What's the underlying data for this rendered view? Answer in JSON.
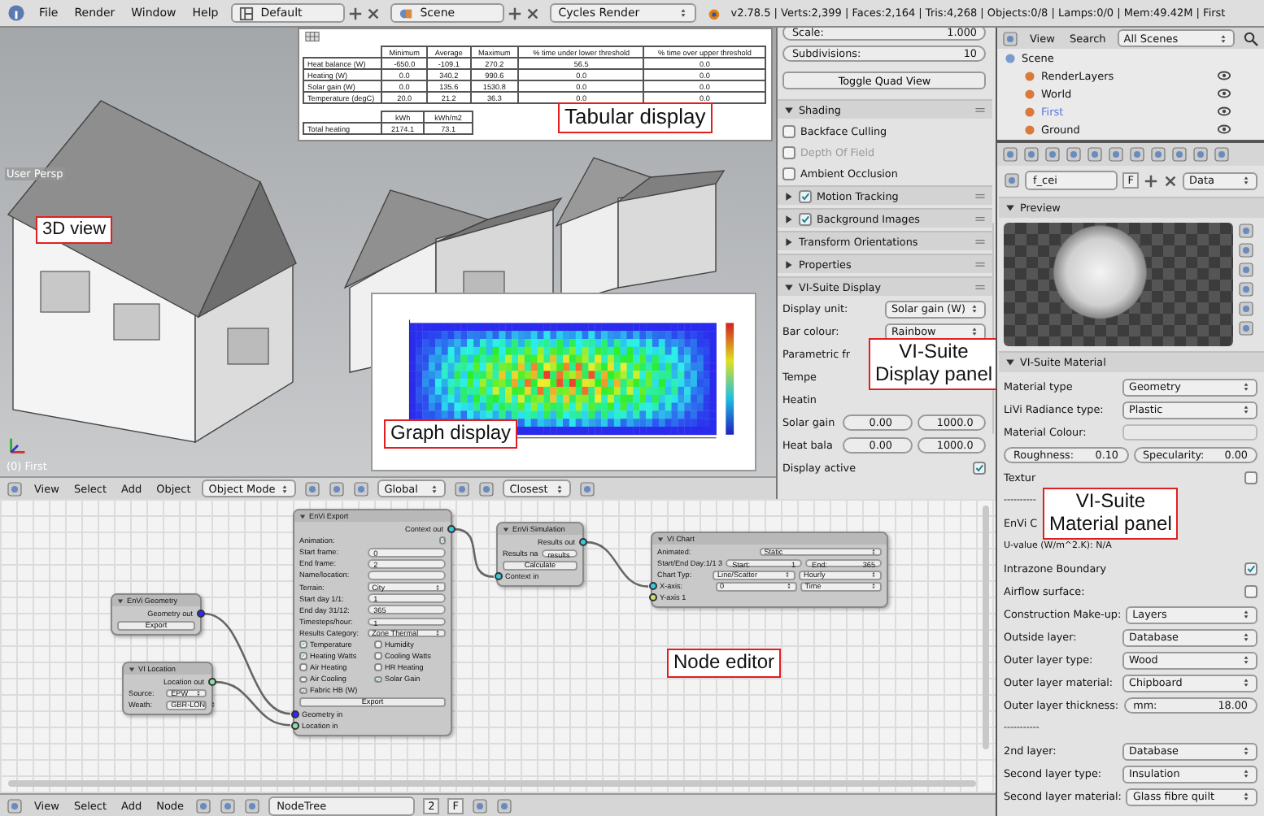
{
  "top_bar": {
    "menus": [
      "File",
      "Render",
      "Window",
      "Help"
    ],
    "layout": "Default",
    "scene": "Scene",
    "engine": "Cycles Render",
    "stats": "v2.78.5 | Verts:2,399 | Faces:2,164 | Tris:4,268 | Objects:0/8 | Lamps:0/0 | Mem:49.42M | First"
  },
  "viewport": {
    "view_label": "User Persp",
    "object_label": "(0) First",
    "annotation": "3D view",
    "header": {
      "menus": [
        "View",
        "Select",
        "Add",
        "Object"
      ],
      "mode": "Object Mode",
      "orientation": "Global",
      "snap": "Closest"
    }
  },
  "tabular_display": {
    "annotation": "Tabular display",
    "columns": [
      "Minimum",
      "Average",
      "Maximum",
      "% time under lower threshold",
      "% time over upper threshold"
    ],
    "rows": [
      {
        "label": "Heat balance (W)",
        "cells": [
          "-650.0",
          "-109.1",
          "270.2",
          "56.5",
          "0.0"
        ]
      },
      {
        "label": "Heating (W)",
        "cells": [
          "0.0",
          "340.2",
          "990.6",
          "0.0",
          "0.0"
        ]
      },
      {
        "label": "Solar gain (W)",
        "cells": [
          "0.0",
          "135.6",
          "1530.8",
          "0.0",
          "0.0"
        ]
      },
      {
        "label": "Temperature (degC)",
        "cells": [
          "20.0",
          "21.2",
          "36.3",
          "0.0",
          "0.0"
        ]
      }
    ],
    "totals_columns": [
      "kWh",
      "kWh/m2"
    ],
    "totals_rows": [
      {
        "label": "Total heating",
        "cells": [
          "2174.1",
          "73.1"
        ]
      }
    ]
  },
  "graph_display": {
    "annotation": "Graph display"
  },
  "view_panel": {
    "annotation": [
      "VI-Suite",
      "Display panel"
    ],
    "items": [
      {
        "kind": "numfield",
        "label": "Scale:",
        "value": "1.000"
      },
      {
        "kind": "numfield",
        "label": "Subdivisions:",
        "value": "10"
      },
      {
        "kind": "button",
        "label": "Toggle Quad View"
      },
      {
        "kind": "panel",
        "title": "Shading",
        "expanded": true
      },
      {
        "kind": "checkbox",
        "label": "Backface Culling",
        "checked": false,
        "disabled": false
      },
      {
        "kind": "checkbox",
        "label": "Depth Of Field",
        "checked": false,
        "disabled": true
      },
      {
        "kind": "checkbox",
        "label": "Ambient Occlusion",
        "checked": false,
        "disabled": false
      },
      {
        "kind": "panel",
        "title": "Motion Tracking",
        "expanded": false,
        "checked": true
      },
      {
        "kind": "panel",
        "title": "Background Images",
        "expanded": false,
        "checked": true
      },
      {
        "kind": "panel",
        "title": "Transform Orientations",
        "expanded": false
      },
      {
        "kind": "panel",
        "title": "Properties",
        "expanded": false
      },
      {
        "kind": "panel",
        "title": "VI-Suite Display",
        "expanded": true
      },
      {
        "kind": "dropdown",
        "label": "Display unit:",
        "value": "Solar gain (W)"
      },
      {
        "kind": "dropdown",
        "label": "Bar colour:",
        "value": "Rainbow"
      },
      {
        "kind": "covered",
        "label": "Parametric fr"
      },
      {
        "kind": "covered",
        "label": "Tempe"
      },
      {
        "kind": "covered",
        "label": "Heatin"
      },
      {
        "kind": "range",
        "label": "Solar gain",
        "min": "0.00",
        "max": "1000.0"
      },
      {
        "kind": "range",
        "label": "Heat bala",
        "min": "0.00",
        "max": "1000.0"
      },
      {
        "kind": "toggle",
        "label": "Display active",
        "checked": true
      }
    ]
  },
  "outliner": {
    "menus": [
      "View",
      "Search"
    ],
    "filter": "All Scenes",
    "items": [
      {
        "label": "Scene",
        "selected": false,
        "children": [
          {
            "label": "RenderLayers",
            "selected": false
          },
          {
            "label": "World",
            "selected": false
          },
          {
            "label": "First",
            "selected": true
          },
          {
            "label": "Ground",
            "selected": false
          }
        ]
      }
    ]
  },
  "properties": {
    "material_name": "f_cei",
    "fake_user": "F",
    "link": "Data",
    "preview_title": "Preview",
    "panel_title": "VI-Suite Material",
    "annotation": [
      "VI-Suite",
      "Material panel"
    ],
    "items": [
      {
        "kind": "dropdown",
        "label": "Material type",
        "value": "Geometry"
      },
      {
        "kind": "dropdown",
        "label": "LiVi Radiance type:",
        "value": "Plastic"
      },
      {
        "kind": "swatch",
        "label": "Material Colour:"
      },
      {
        "kind": "pair",
        "fields": [
          {
            "label": "Roughness:",
            "value": "0.10"
          },
          {
            "label": "Specularity:",
            "value": "0.00"
          }
        ]
      },
      {
        "kind": "toggle",
        "label": "Textur",
        "checked": false
      },
      {
        "kind": "text",
        "label": "----------"
      },
      {
        "kind": "covered",
        "label": "EnVi C"
      },
      {
        "kind": "text",
        "label": "U-value (W/m^2.K): N/A"
      },
      {
        "kind": "toggle",
        "label": "Intrazone Boundary",
        "checked": true
      },
      {
        "kind": "toggle",
        "label": "Airflow surface:",
        "checked": false
      },
      {
        "kind": "dropdown",
        "label": "Construction Make-up:",
        "value": "Layers"
      },
      {
        "kind": "dropdown",
        "label": "Outside layer:",
        "value": "Database"
      },
      {
        "kind": "dropdown",
        "label": "Outer layer type:",
        "value": "Wood"
      },
      {
        "kind": "dropdown",
        "label": "Outer layer material:",
        "value": "Chipboard"
      },
      {
        "kind": "numrow",
        "label": "Outer layer thickness:",
        "field": {
          "label": "mm:",
          "value": "18.00"
        }
      },
      {
        "kind": "text",
        "label": "-----------"
      },
      {
        "kind": "dropdown",
        "label": "2nd layer:",
        "value": "Database"
      },
      {
        "kind": "dropdown",
        "label": "Second layer type:",
        "value": "Insulation"
      },
      {
        "kind": "dropdown",
        "label": "Second layer material:",
        "value": "Glass fibre quilt"
      }
    ]
  },
  "node_editor": {
    "annotation": "Node editor",
    "nodes": [
      {
        "title": "EnVi Geometry",
        "rows": [
          {
            "kind": "output",
            "label": "Geometry out",
            "color": "#2a2aff"
          },
          {
            "kind": "button",
            "label": "Export"
          }
        ]
      },
      {
        "title": "VI Location",
        "rows": [
          {
            "kind": "output",
            "label": "Location out",
            "color": "#8fe0a8"
          },
          {
            "kind": "dropdown",
            "label": "Source:",
            "value": "EPW"
          },
          {
            "kind": "dropdown",
            "label": "Weath:",
            "value": "GBR-LON"
          }
        ]
      },
      {
        "title": "EnVi Export",
        "rows": [
          {
            "kind": "output",
            "label": "Context out",
            "color": "#38c8e0"
          },
          {
            "kind": "toggle",
            "label": "Animation:",
            "checked": true
          },
          {
            "kind": "field",
            "label": "Start frame:",
            "value": "0"
          },
          {
            "kind": "field",
            "label": "End frame:",
            "value": "2"
          },
          {
            "kind": "emptyfield",
            "label": "Name/location:"
          },
          {
            "kind": "dropdown",
            "label": "Terrain:",
            "value": "City"
          },
          {
            "kind": "field",
            "label": "Start day 1/1:",
            "value": "1"
          },
          {
            "kind": "field",
            "label": "End day 31/12:",
            "value": "365"
          },
          {
            "kind": "field",
            "label": "Timesteps/hour:",
            "value": "1"
          },
          {
            "kind": "dropdown",
            "label": "Results Category:",
            "value": "Zone Thermal"
          },
          {
            "kind": "checks",
            "items": [
              {
                "label": "Temperature",
                "checked": true
              },
              {
                "label": "Humidity",
                "checked": false
              }
            ]
          },
          {
            "kind": "checks",
            "items": [
              {
                "label": "Heating Watts",
                "checked": true
              },
              {
                "label": "Cooling Watts",
                "checked": false
              }
            ]
          },
          {
            "kind": "checks",
            "items": [
              {
                "label": "Air Heating",
                "checked": false
              },
              {
                "label": "HR Heating",
                "checked": false
              }
            ]
          },
          {
            "kind": "checks",
            "items": [
              {
                "label": "Air Cooling",
                "checked": false
              },
              {
                "label": "Solar Gain",
                "checked": true
              }
            ]
          },
          {
            "kind": "checks",
            "items": [
              {
                "label": "Fabric HB (W)",
                "checked": true
              }
            ]
          },
          {
            "kind": "button",
            "label": "Export"
          },
          {
            "kind": "input",
            "label": "Geometry in",
            "color": "#2a2aff"
          },
          {
            "kind": "input",
            "label": "Location in",
            "color": "#8fe0a8"
          }
        ]
      },
      {
        "title": "EnVi Simulation",
        "rows": [
          {
            "kind": "output",
            "label": "Results out",
            "color": "#38c8e0"
          },
          {
            "kind": "field",
            "label": "Results na",
            "value": "results"
          },
          {
            "kind": "button",
            "label": "Calculate"
          },
          {
            "kind": "input",
            "label": "Context in",
            "color": "#38c8e0"
          }
        ]
      },
      {
        "title": "VI Chart",
        "rows": [
          {
            "kind": "dropdown",
            "label": "Animated:",
            "value": "Static"
          },
          {
            "kind": "double",
            "label": "Start/End Day:1/1 3",
            "fields": [
              {
                "label": "Start:",
                "value": "1"
              },
              {
                "label": "End:",
                "value": "365"
              }
            ]
          },
          {
            "kind": "double",
            "label": "Chart Typ:",
            "fields": [
              {
                "label": "Line/Scatter"
              },
              {
                "label": "Hourly"
              }
            ]
          },
          {
            "kind": "double",
            "label": "X-axis:",
            "color": "#38c8e0",
            "fields": [
              {
                "label": "0"
              },
              {
                "label": "Time"
              }
            ]
          },
          {
            "kind": "input",
            "label": "Y-axis 1",
            "color": "#c8e070"
          }
        ]
      }
    ],
    "header": {
      "menus": [
        "View",
        "Select",
        "Add",
        "Node"
      ],
      "tree": "NodeTree",
      "users": "2",
      "fake_user": "F"
    }
  }
}
